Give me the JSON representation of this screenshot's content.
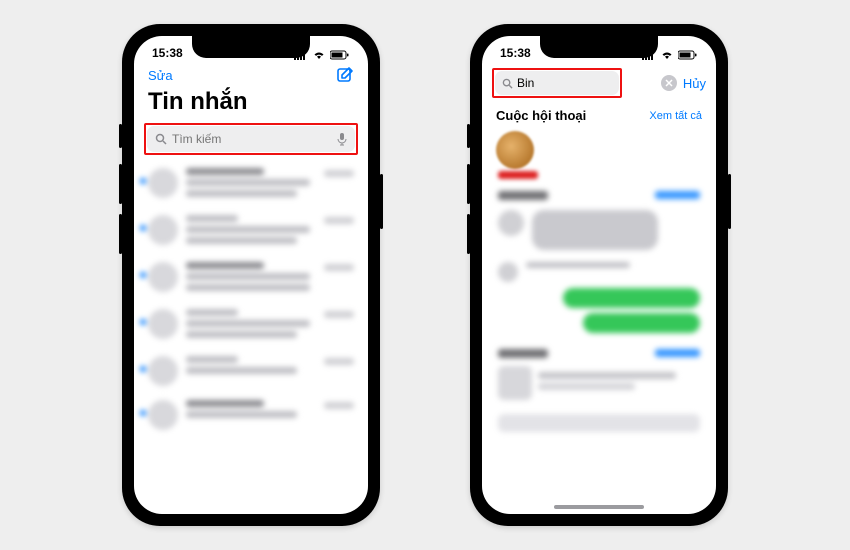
{
  "statusBar": {
    "time": "15:38"
  },
  "leftPhone": {
    "navEdit": "Sửa",
    "title": "Tin nhắn",
    "searchPlaceholder": "Tìm kiếm"
  },
  "rightPhone": {
    "searchValue": "Bin",
    "cancel": "Hủy",
    "sectionConversations": "Cuộc hội thoại",
    "seeAll": "Xem tất cả"
  }
}
